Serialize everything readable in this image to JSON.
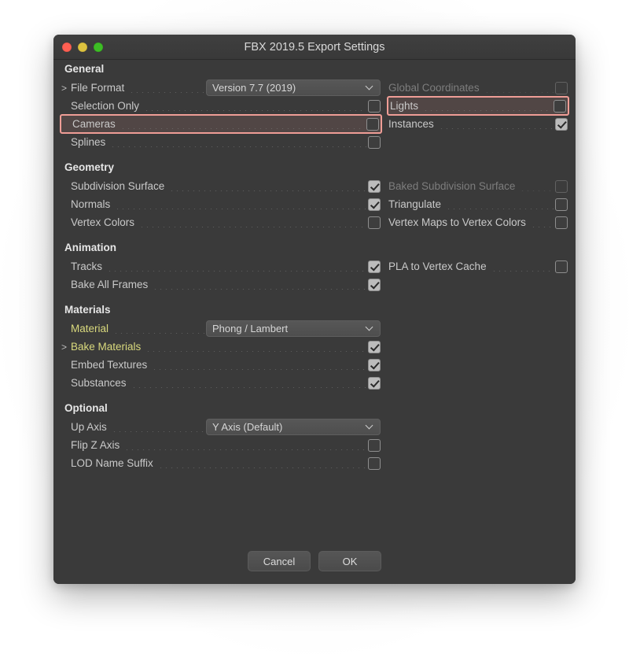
{
  "window": {
    "title": "FBX 2019.5 Export Settings",
    "traffic_lights": [
      {
        "name": "close-button",
        "color": "#ff5f52"
      },
      {
        "name": "minimize-button",
        "color": "#ddc23f"
      },
      {
        "name": "zoom-button",
        "color": "#3dbd25"
      }
    ]
  },
  "theme": {
    "window_bg": "#3a3a3a",
    "label": "#c9c9c9",
    "label_disabled": "#7d7d7d",
    "accent_yellow": "#d9d97d",
    "highlight_border": "#ef9d96"
  },
  "sections": {
    "general": {
      "title": "General",
      "left_rows": [
        {
          "label": "File Format",
          "disclosure": ">",
          "control": "dropdown",
          "value": "Version 7.7 (2019)",
          "dots": 5,
          "disabled": false,
          "highlighted": false
        },
        {
          "label": "Selection Only",
          "disclosure": "",
          "control": "checkbox",
          "checked": false,
          "dots": 4,
          "disabled": false,
          "highlighted": false
        },
        {
          "label": "Cameras",
          "disclosure": "",
          "control": "checkbox",
          "checked": false,
          "dots": 7,
          "disabled": false,
          "highlighted": true
        },
        {
          "label": "Splines",
          "disclosure": "",
          "control": "checkbox",
          "checked": false,
          "dots": 8,
          "disabled": false,
          "highlighted": false
        }
      ],
      "right_rows": [
        {
          "label": "Global Coordinates",
          "control": "checkbox",
          "checked": false,
          "disabled": true,
          "highlighted": false
        },
        {
          "label": "Lights",
          "control": "checkbox",
          "checked": false,
          "disabled": false,
          "highlighted": true
        },
        {
          "label": "Instances",
          "control": "checkbox",
          "checked": true,
          "disabled": false,
          "highlighted": false
        }
      ]
    },
    "geometry": {
      "title": "Geometry",
      "left_rows": [
        {
          "label": "Subdivision Surface",
          "disclosure": "",
          "control": "checkbox",
          "checked": true,
          "dots": 0,
          "disabled": false,
          "highlighted": false
        },
        {
          "label": "Normals",
          "disclosure": "",
          "control": "checkbox",
          "checked": true,
          "dots": 8,
          "disabled": false,
          "highlighted": false
        },
        {
          "label": "Vertex Colors",
          "disclosure": "",
          "control": "checkbox",
          "checked": false,
          "dots": 5,
          "disabled": false,
          "highlighted": false
        }
      ],
      "right_rows": [
        {
          "label": "Baked Subdivision Surface",
          "control": "checkbox",
          "checked": false,
          "disabled": true,
          "highlighted": false
        },
        {
          "label": "Triangulate",
          "control": "checkbox",
          "checked": false,
          "disabled": false,
          "highlighted": false
        },
        {
          "label": "Vertex Maps to Vertex Colors",
          "control": "checkbox",
          "checked": false,
          "disabled": false,
          "highlighted": false
        }
      ]
    },
    "animation": {
      "title": "Animation",
      "left_rows": [
        {
          "label": "Tracks",
          "disclosure": "",
          "control": "checkbox",
          "checked": true,
          "dots": 9,
          "disabled": false,
          "highlighted": false
        },
        {
          "label": "Bake All Frames",
          "disclosure": "",
          "control": "checkbox",
          "checked": true,
          "dots": 3,
          "disabled": false,
          "highlighted": false
        }
      ],
      "right_rows": [
        {
          "label": "PLA to Vertex Cache",
          "control": "checkbox",
          "checked": false,
          "disabled": false,
          "highlighted": false
        }
      ]
    },
    "materials": {
      "title": "Materials",
      "left_rows": [
        {
          "label": "Material",
          "disclosure": "",
          "control": "dropdown",
          "value": "Phong / Lambert",
          "dots": 8,
          "disabled": false,
          "accent": true,
          "highlighted": false
        },
        {
          "label": "Bake Materials",
          "disclosure": ">",
          "control": "checkbox",
          "checked": true,
          "dots": 2,
          "disabled": false,
          "accent": true,
          "highlighted": false
        },
        {
          "label": "Embed Textures",
          "disclosure": "",
          "control": "checkbox",
          "checked": true,
          "dots": 3,
          "disabled": false,
          "highlighted": false
        },
        {
          "label": "Substances",
          "disclosure": "",
          "control": "checkbox",
          "checked": true,
          "dots": 6,
          "disabled": false,
          "highlighted": false
        }
      ],
      "right_rows": []
    },
    "optional": {
      "title": "Optional",
      "left_rows": [
        {
          "label": "Up Axis",
          "disclosure": "",
          "control": "dropdown",
          "value": "Y Axis (Default)",
          "dots": 8,
          "disabled": false,
          "highlighted": false
        },
        {
          "label": "Flip Z Axis",
          "disclosure": "",
          "control": "checkbox",
          "checked": false,
          "dots": 6,
          "disabled": false,
          "highlighted": false
        },
        {
          "label": "LOD Name Suffix",
          "disclosure": "",
          "control": "checkbox",
          "checked": false,
          "dots": 2,
          "disabled": false,
          "highlighted": false
        }
      ],
      "right_rows": []
    }
  },
  "footer": {
    "cancel_label": "Cancel",
    "ok_label": "OK"
  }
}
